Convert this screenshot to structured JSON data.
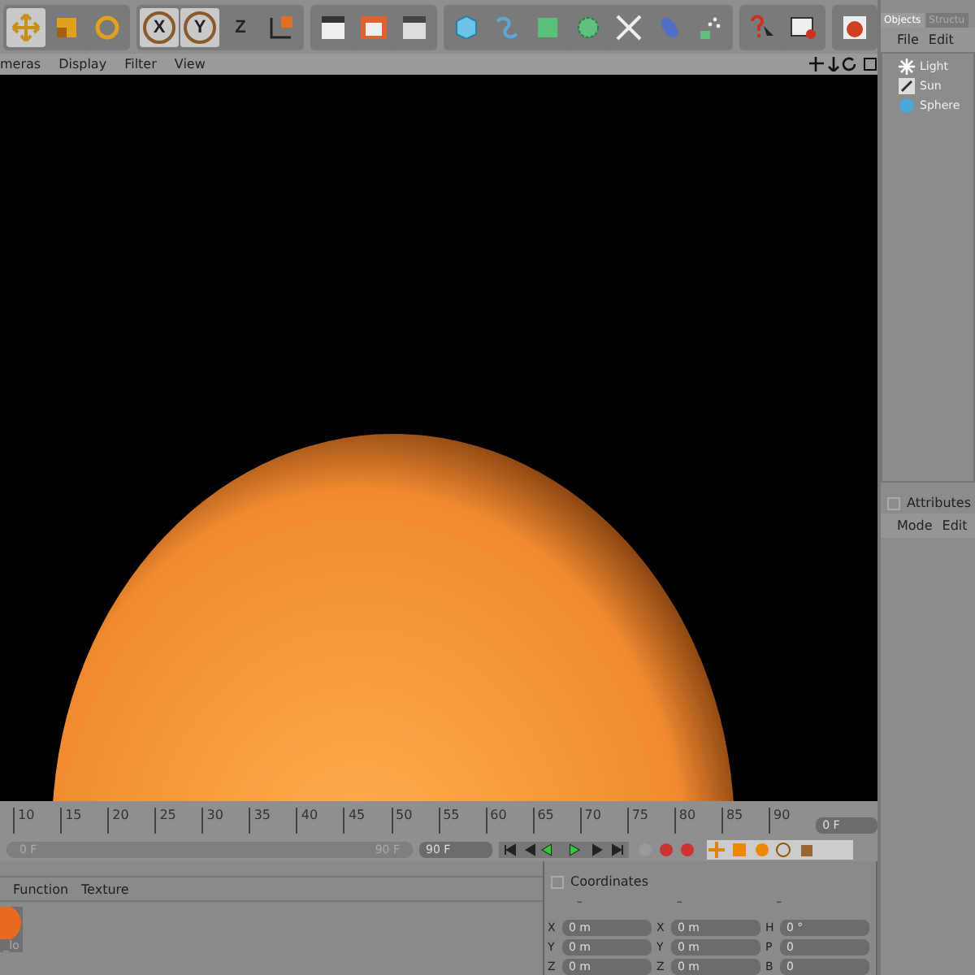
{
  "toolbar": {
    "axis_buttons": [
      {
        "label": "X",
        "selected": true
      },
      {
        "label": "Y",
        "selected": true
      },
      {
        "label": "Z",
        "selected": false
      }
    ]
  },
  "viewport": {
    "menu": [
      "meras",
      "Display",
      "Filter",
      "View"
    ]
  },
  "objects_panel": {
    "tabs": [
      {
        "label": "Objects",
        "selected": true
      },
      {
        "label": "Structu",
        "selected": false
      }
    ],
    "menu": [
      "File",
      "Edit"
    ],
    "items": [
      {
        "name": "Light",
        "kind": "light"
      },
      {
        "name": "Sun",
        "kind": "sun"
      },
      {
        "name": "Sphere",
        "kind": "sphere"
      }
    ]
  },
  "attributes_panel": {
    "title": "Attributes",
    "checked": false,
    "menu": [
      "Mode",
      "Edit"
    ]
  },
  "timeline": {
    "ticks": [
      "10",
      "15",
      "20",
      "25",
      "30",
      "35",
      "40",
      "45",
      "50",
      "55",
      "60",
      "65",
      "70",
      "75",
      "80",
      "85",
      "90"
    ],
    "current_frame": "0 F",
    "range": {
      "start": "0 F",
      "end": "90 F",
      "level": 1
    },
    "end_frame": "90 F"
  },
  "material_panel": {
    "menu": [
      "Function",
      "Texture"
    ],
    "materials": [
      {
        "name": "_lo"
      }
    ]
  },
  "coordinates": {
    "title": "Coordinates",
    "checked": false,
    "headers": [
      "–",
      "–",
      "–"
    ],
    "rows": [
      {
        "axis": "X",
        "position": "0 m",
        "size_axis": "X",
        "size": "0 m",
        "rot_axis": "H",
        "rotation": "0 °"
      },
      {
        "axis": "Y",
        "position": "0 m",
        "size_axis": "Y",
        "size": "0 m",
        "rot_axis": "P",
        "rotation": "0"
      },
      {
        "axis": "Z",
        "position": "0 m",
        "size_axis": "Z",
        "size": "0 m",
        "rot_axis": "B",
        "rotation": "0"
      }
    ]
  }
}
